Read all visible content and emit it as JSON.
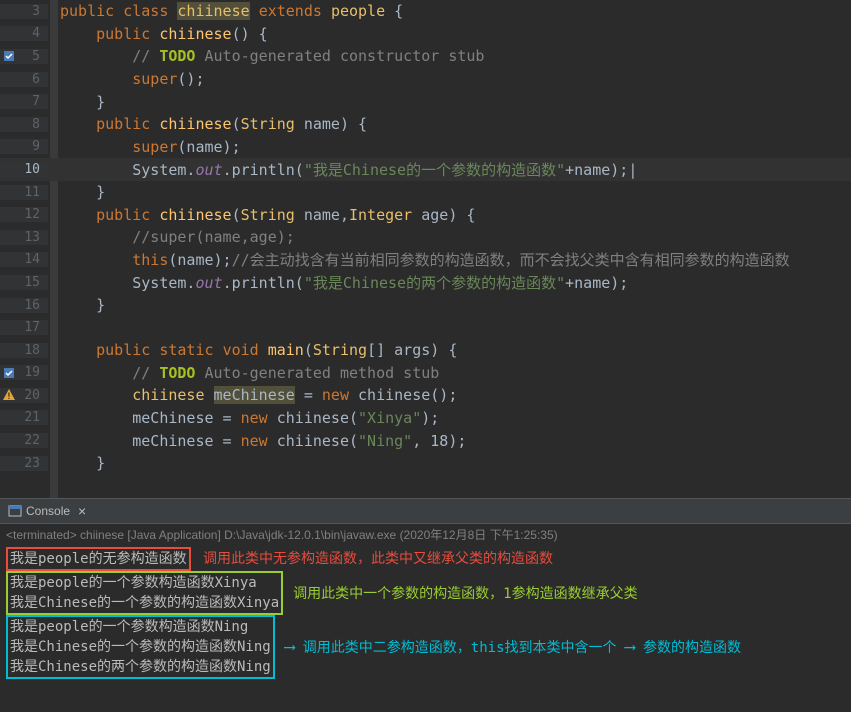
{
  "editor": {
    "lines": [
      {
        "num": "3",
        "tokens": [
          {
            "t": "public",
            "c": "kw"
          },
          {
            "t": " "
          },
          {
            "t": "class",
            "c": "kw"
          },
          {
            "t": " "
          },
          {
            "t": "chiinese",
            "c": "cls warn"
          },
          {
            "t": " "
          },
          {
            "t": "extends",
            "c": "kw"
          },
          {
            "t": " "
          },
          {
            "t": "people",
            "c": "cls"
          },
          {
            "t": " {"
          }
        ],
        "indent": 0
      },
      {
        "num": "4",
        "fold": true,
        "tokens": [
          {
            "t": "public",
            "c": "kw"
          },
          {
            "t": " "
          },
          {
            "t": "chiinese",
            "c": "mth"
          },
          {
            "t": "() {"
          }
        ],
        "indent": 1
      },
      {
        "num": "5",
        "icon": "todo",
        "tokens": [
          {
            "t": "// ",
            "c": "cmt"
          },
          {
            "t": "TODO",
            "c": "td"
          },
          {
            "t": " Auto-generated constructor stub",
            "c": "cmt"
          }
        ],
        "indent": 2
      },
      {
        "num": "6",
        "tokens": [
          {
            "t": "super",
            "c": "kw"
          },
          {
            "t": "();"
          }
        ],
        "indent": 2
      },
      {
        "num": "7",
        "tokens": [
          {
            "t": "}"
          }
        ],
        "indent": 1
      },
      {
        "num": "8",
        "fold": true,
        "tokens": [
          {
            "t": "public",
            "c": "kw"
          },
          {
            "t": " "
          },
          {
            "t": "chiinese",
            "c": "mth"
          },
          {
            "t": "("
          },
          {
            "t": "String",
            "c": "cls"
          },
          {
            "t": " name) {"
          }
        ],
        "indent": 1
      },
      {
        "num": "9",
        "tokens": [
          {
            "t": "super",
            "c": "kw"
          },
          {
            "t": "(name);"
          }
        ],
        "indent": 2
      },
      {
        "num": "10",
        "current": true,
        "tokens": [
          {
            "t": "System."
          },
          {
            "t": "out",
            "c": "fld"
          },
          {
            "t": ".println("
          },
          {
            "t": "\"我是Chinese的一个参数的构造函数\"",
            "c": "str"
          },
          {
            "t": "+name);|"
          }
        ],
        "indent": 2
      },
      {
        "num": "11",
        "tokens": [
          {
            "t": "}"
          }
        ],
        "indent": 1
      },
      {
        "num": "12",
        "fold": true,
        "tokens": [
          {
            "t": "public",
            "c": "kw"
          },
          {
            "t": " "
          },
          {
            "t": "chiinese",
            "c": "mth"
          },
          {
            "t": "("
          },
          {
            "t": "String",
            "c": "cls"
          },
          {
            "t": " name,"
          },
          {
            "t": "Integer",
            "c": "cls"
          },
          {
            "t": " age) {"
          }
        ],
        "indent": 1
      },
      {
        "num": "13",
        "tokens": [
          {
            "t": "//super(name,age);",
            "c": "cmt"
          }
        ],
        "indent": 2
      },
      {
        "num": "14",
        "tokens": [
          {
            "t": "this",
            "c": "kw"
          },
          {
            "t": "(name);"
          },
          {
            "t": "//会主动找含有当前相同参数的构造函数，而不会找父类中含有相同参数的构造函数",
            "c": "cmt"
          }
        ],
        "indent": 2
      },
      {
        "num": "15",
        "tokens": [
          {
            "t": "System."
          },
          {
            "t": "out",
            "c": "fld"
          },
          {
            "t": ".println("
          },
          {
            "t": "\"我是Chinese的两个参数的构造函数\"",
            "c": "str"
          },
          {
            "t": "+name);"
          }
        ],
        "indent": 2
      },
      {
        "num": "16",
        "tokens": [
          {
            "t": "}"
          }
        ],
        "indent": 1
      },
      {
        "num": "17",
        "tokens": [],
        "indent": 1
      },
      {
        "num": "18",
        "fold": true,
        "tokens": [
          {
            "t": "public",
            "c": "kw"
          },
          {
            "t": " "
          },
          {
            "t": "static",
            "c": "kw"
          },
          {
            "t": " "
          },
          {
            "t": "void",
            "c": "kw"
          },
          {
            "t": " "
          },
          {
            "t": "main",
            "c": "mth"
          },
          {
            "t": "("
          },
          {
            "t": "String",
            "c": "cls"
          },
          {
            "t": "[] args) {"
          }
        ],
        "indent": 1
      },
      {
        "num": "19",
        "icon": "todo",
        "tokens": [
          {
            "t": "// ",
            "c": "cmt"
          },
          {
            "t": "TODO",
            "c": "td"
          },
          {
            "t": " Auto-generated method stub",
            "c": "cmt"
          }
        ],
        "indent": 2
      },
      {
        "num": "20",
        "icon": "warn",
        "tokens": [
          {
            "t": "chiinese",
            "c": "cls"
          },
          {
            "t": " "
          },
          {
            "t": "meChinese",
            "c": "warn"
          },
          {
            "t": " = "
          },
          {
            "t": "new",
            "c": "kw"
          },
          {
            "t": " chiinese();"
          }
        ],
        "indent": 2
      },
      {
        "num": "21",
        "tokens": [
          {
            "t": "meChinese = "
          },
          {
            "t": "new",
            "c": "kw"
          },
          {
            "t": " chiinese("
          },
          {
            "t": "\"Xinya\"",
            "c": "str"
          },
          {
            "t": ");"
          }
        ],
        "indent": 2
      },
      {
        "num": "22",
        "tokens": [
          {
            "t": "meChinese = "
          },
          {
            "t": "new",
            "c": "kw"
          },
          {
            "t": " chiinese("
          },
          {
            "t": "\"Ning\"",
            "c": "str"
          },
          {
            "t": ", 18);"
          }
        ],
        "indent": 2
      },
      {
        "num": "23",
        "tokens": [
          {
            "t": "}"
          }
        ],
        "indent": 1
      }
    ]
  },
  "console": {
    "tab_label": "Console",
    "header": "<terminated> chiinese [Java Application] D:\\Java\\jdk-12.0.1\\bin\\javaw.exe (2020年12月8日 下午1:25:35)",
    "output": {
      "line1": "我是people的无参构造函数",
      "ann1": "调用此类中无参构造函数，此类中又继承父类的构造函数",
      "line2": "我是people的一个参数构造函数Xinya",
      "line3": "我是Chinese的一个参数的构造函数Xinya",
      "ann2": "调用此类中一个参数的构造函数，1参构造函数继承父类",
      "line4": "我是people的一个参数构造函数Ning",
      "line5": "我是Chinese的一个参数的构造函数Ning",
      "line6": "我是Chinese的两个参数的构造函数Ning",
      "ann3": "调用此类中二参构造函数，this找到本类中含一个",
      "ann3b": "参数的构造函数"
    }
  }
}
